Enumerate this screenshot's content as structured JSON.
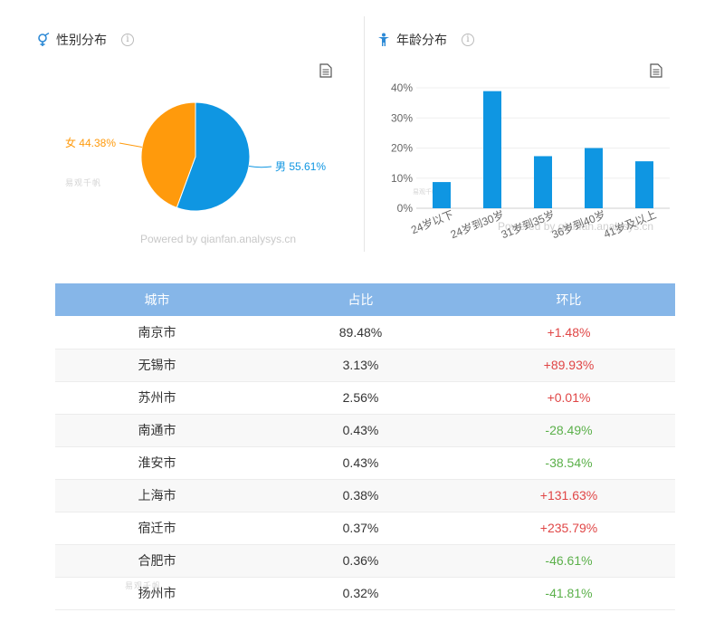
{
  "gender_panel": {
    "title": "性别分布",
    "powered_by": "Powered by qianfan.analysys.cn",
    "watermark": "易观千帆",
    "chart_data": {
      "type": "pie",
      "title": "性别分布",
      "slices": [
        {
          "name": "男",
          "value": 55.61,
          "label": "男 55.61%",
          "color": "#0f96e2"
        },
        {
          "name": "女",
          "value": 44.38,
          "label": "女 44.38%",
          "color": "#ff9a0c"
        }
      ]
    }
  },
  "age_panel": {
    "title": "年龄分布",
    "watermark": "易观千帆",
    "powered_by_overlap": "Powered by qianfan.analysys.cn",
    "chart_data": {
      "type": "bar",
      "title": "年龄分布",
      "categories": [
        "24岁以下",
        "24岁到30岁",
        "31岁到35岁",
        "36岁到40岁",
        "41岁及以上"
      ],
      "values": [
        8.7,
        38.9,
        17.3,
        20.0,
        15.6
      ],
      "ylim": [
        0,
        40
      ],
      "yticks": [
        "0%",
        "10%",
        "20%",
        "30%",
        "40%"
      ],
      "grid": true,
      "color": "#0f96e2"
    }
  },
  "city_table": {
    "headers": [
      "城市",
      "占比",
      "环比"
    ],
    "rows": [
      {
        "city": "南京市",
        "share": "89.48%",
        "change": "+1.48%",
        "dir": "up"
      },
      {
        "city": "无锡市",
        "share": "3.13%",
        "change": "+89.93%",
        "dir": "up"
      },
      {
        "city": "苏州市",
        "share": "2.56%",
        "change": "+0.01%",
        "dir": "up"
      },
      {
        "city": "南通市",
        "share": "0.43%",
        "change": "-28.49%",
        "dir": "down"
      },
      {
        "city": "淮安市",
        "share": "0.43%",
        "change": "-38.54%",
        "dir": "down"
      },
      {
        "city": "上海市",
        "share": "0.38%",
        "change": "+131.63%",
        "dir": "up"
      },
      {
        "city": "宿迁市",
        "share": "0.37%",
        "change": "+235.79%",
        "dir": "up"
      },
      {
        "city": "合肥市",
        "share": "0.36%",
        "change": "-46.61%",
        "dir": "down"
      },
      {
        "city": "扬州市",
        "share": "0.32%",
        "change": "-41.81%",
        "dir": "down"
      }
    ],
    "watermark": "易观千帆"
  },
  "colors": {
    "up": "#e04646",
    "down": "#5bb04a",
    "header": "#86b6e8",
    "accent": "#0f96e2"
  }
}
